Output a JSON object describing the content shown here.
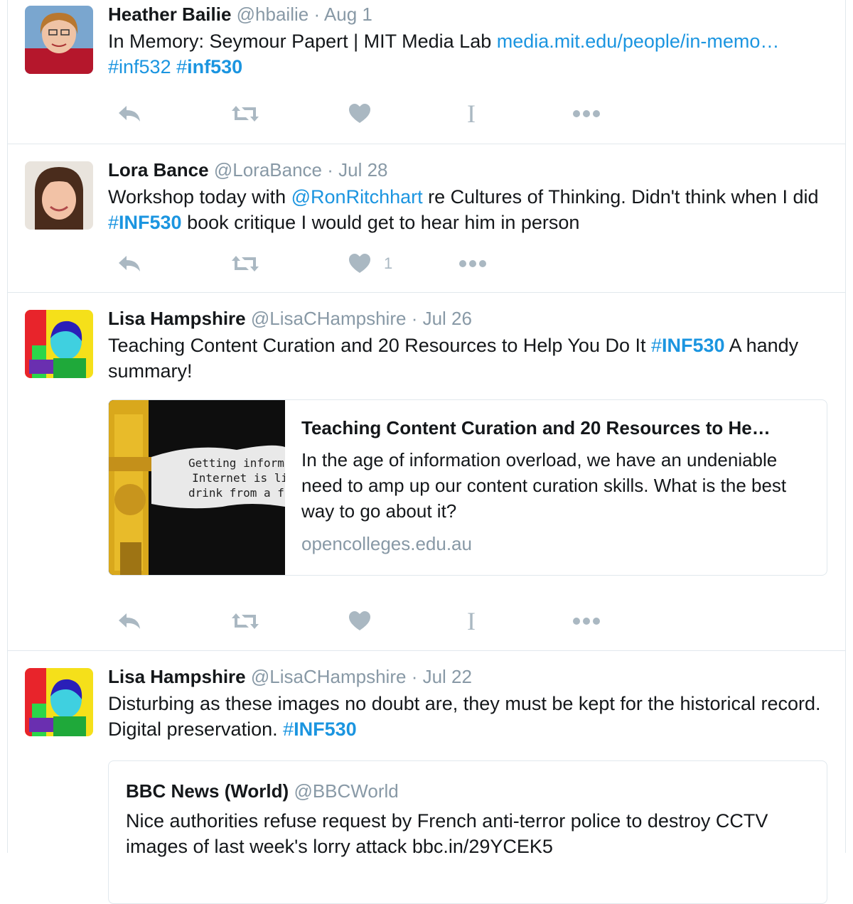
{
  "tweets": [
    {
      "name": "Heather Bailie",
      "handle": "@hbailie",
      "sep": "·",
      "date": "Aug 1",
      "text_before": "In Memory: Seymour Papert | MIT Media Lab ",
      "link": "media.mit.edu/people/in-memo…",
      "tag1": "#inf532",
      "tag2_hash": "#",
      "tag2_word": "inf530",
      "like_count": ""
    },
    {
      "name": "Lora Bance",
      "handle": "@LoraBance",
      "sep": "·",
      "date": "Jul 28",
      "text_1": "Workshop today with ",
      "mention": "@RonRitchhart",
      "text_2": " re Cultures of Thinking. Didn't think when I did ",
      "tag_hash": "#",
      "tag_word": "INF530",
      "text_3": " book critique I would get to hear him in person",
      "like_count": "1"
    },
    {
      "name": "Lisa Hampshire",
      "handle": "@LisaCHampshire",
      "sep": "·",
      "date": "Jul 26",
      "text_1": "Teaching Content Curation and 20 Resources to Help You Do It ",
      "tag_hash": "#",
      "tag_word": "INF530",
      "text_2": " A handy summary!",
      "card": {
        "title": "Teaching Content Curation and 20 Resources to He…",
        "description": "In the age of information overload, we have an undeniable need to amp up our content curation skills. What is the best way to go about it?",
        "domain": "opencolleges.edu.au",
        "image_text": [
          "Getting informat",
          "Internet is li",
          "drink from a fi"
        ]
      },
      "like_count": ""
    },
    {
      "name": "Lisa Hampshire",
      "handle": "@LisaCHampshire",
      "sep": "·",
      "date": "Jul 22",
      "text_1": "Disturbing as these images no doubt are, they must be kept for the historical record.  Digital preservation. ",
      "tag_hash": "#",
      "tag_word": "INF530",
      "quote": {
        "name": "BBC News (World)",
        "handle": "@BBCWorld",
        "text": "Nice authorities refuse request by French anti-terror police to destroy CCTV images of last week's lorry attack ",
        "link": "bbc.in/29YCEK5"
      }
    }
  ],
  "colors": {
    "link": "#1b95e0",
    "muted": "#8899a6",
    "icon": "#aab8c2",
    "border": "#e1e8ed"
  },
  "icons": [
    "reply-icon",
    "retweet-icon",
    "heart-icon",
    "text-cursor-icon",
    "more-icon"
  ],
  "icon_glyphs": {
    "text_cursor": "I"
  }
}
